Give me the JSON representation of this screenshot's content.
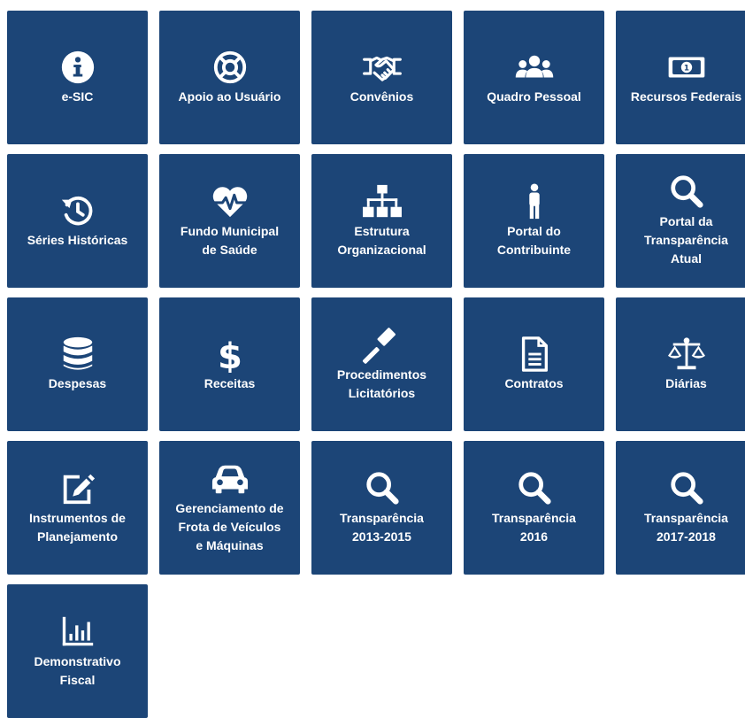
{
  "tiles": [
    {
      "label": "e-SIC",
      "icon": "info-icon"
    },
    {
      "label": "Apoio ao Usuário",
      "icon": "lifebuoy-icon"
    },
    {
      "label": "Convênios",
      "icon": "handshake-icon"
    },
    {
      "label": "Quadro Pessoal",
      "icon": "users-icon"
    },
    {
      "label": "Recursos Federais",
      "icon": "money-bill-icon"
    },
    {
      "label": "Séries Históricas",
      "icon": "history-icon"
    },
    {
      "label": "Fundo Municipal\nde Saúde",
      "icon": "heartbeat-icon"
    },
    {
      "label": "Estrutura\nOrganizacional",
      "icon": "sitemap-icon"
    },
    {
      "label": "Portal do\nContribuinte",
      "icon": "person-icon"
    },
    {
      "label": "Portal da\nTransparência\nAtual",
      "icon": "search-icon"
    },
    {
      "label": "Despesas",
      "icon": "database-icon"
    },
    {
      "label": "Receitas",
      "icon": "dollar-icon"
    },
    {
      "label": "Procedimentos\nLicitatórios",
      "icon": "gavel-icon"
    },
    {
      "label": "Contratos",
      "icon": "file-icon"
    },
    {
      "label": "Diárias",
      "icon": "balance-scale-icon"
    },
    {
      "label": "Instrumentos de\nPlanejamento",
      "icon": "edit-icon"
    },
    {
      "label": "Gerenciamento de\nFrota de Veículos\ne Máquinas",
      "icon": "car-icon"
    },
    {
      "label": "Transparência\n2013-2015",
      "icon": "search-icon"
    },
    {
      "label": "Transparência\n2016",
      "icon": "search-icon"
    },
    {
      "label": "Transparência\n2017-2018",
      "icon": "search-icon"
    },
    {
      "label": "Demonstrativo\nFiscal",
      "icon": "bar-chart-icon"
    }
  ],
  "colors": {
    "tile_bg": "#1c4577",
    "tile_text": "#ffffff"
  }
}
